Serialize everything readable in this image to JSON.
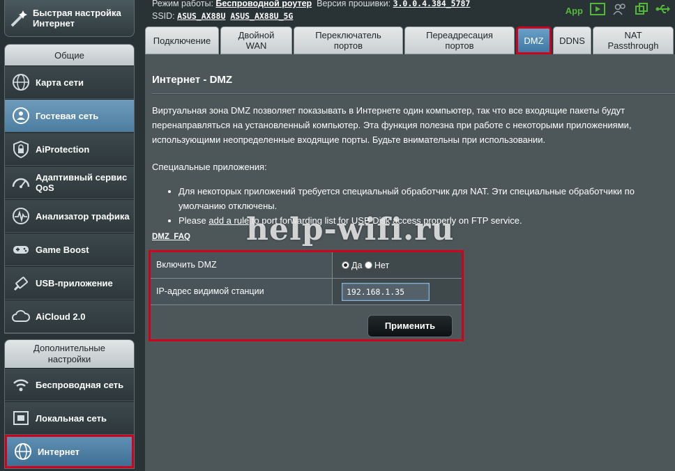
{
  "header": {
    "mode_label": "Режим работы:",
    "mode_value": "Беспроводной роутер",
    "firmware_label": "Версия прошивки:",
    "firmware_value": "3.0.0.4.384_5787",
    "ssid_label": "SSID:",
    "ssid_1": "ASUS_AX88U",
    "ssid_2": "ASUS_AX88U_5G",
    "app_label": "App"
  },
  "sidebar": {
    "quick_setup": "Быстрая настройка Интернет",
    "general_title": "Общие",
    "general_items": [
      {
        "label": "Карта сети",
        "icon": "globe-network-icon"
      },
      {
        "label": "Гостевая сеть",
        "icon": "guest-network-icon"
      },
      {
        "label": "AiProtection",
        "icon": "shield-lock-icon"
      },
      {
        "label": "Адаптивный сервис QoS",
        "icon": "speedometer-icon"
      },
      {
        "label": "Анализатор трафика",
        "icon": "traffic-analyzer-icon"
      },
      {
        "label": "Game Boost",
        "icon": "gamepad-icon"
      },
      {
        "label": "USB-приложение",
        "icon": "usb-icon"
      },
      {
        "label": "AiCloud 2.0",
        "icon": "cloud-icon"
      }
    ],
    "advanced_title": "Дополнительные настройки",
    "advanced_items": [
      {
        "label": "Беспроводная сеть",
        "icon": "wireless-icon"
      },
      {
        "label": "Локальная сеть",
        "icon": "lan-icon"
      },
      {
        "label": "Интернет",
        "icon": "globe-icon"
      }
    ]
  },
  "tabs": [
    "Подключение",
    "Двойной WAN",
    "Переключатель портов",
    "Переадресация портов",
    "DMZ",
    "DDNS",
    "NAT Passthrough"
  ],
  "content": {
    "title": "Интернет - DMZ",
    "description": "Виртуальная зона DMZ позволяет показывать в Интернете один компьютер, так что все входящие пакеты будут перенаправляться на установленный компьютер. Эта функция полезна при работе с некоторыми приложениями, использующими неопределенные входящие порты. Будьте внимательны при использовании.",
    "special_apps_label": "Специальные приложения:",
    "bullet_1": "Для некоторых приложений требуется специальный обработчик для NAT. Эти специальные обработчики по умолчанию отключены.",
    "bullet_2_prefix": "Please",
    "bullet_2_link": "add a rule",
    "bullet_2_suffix": "to port forwarding list for USB Disk access properly on FTP service.",
    "faq_link": "DMZ_FAQ",
    "watermark": "help-wifi.ru"
  },
  "form": {
    "enable_label": "Включить DMZ",
    "option_yes": "Да",
    "option_no": "Нет",
    "enable_value": "Да",
    "ip_label": "IP-адрес видимой станции",
    "ip_value": "192.168.1.35",
    "apply_label": "Применить"
  },
  "colors": {
    "highlight": "#d0021b",
    "active_blue": "#4c7da0",
    "panel": "#4d5659",
    "app_green": "#53b83a"
  }
}
